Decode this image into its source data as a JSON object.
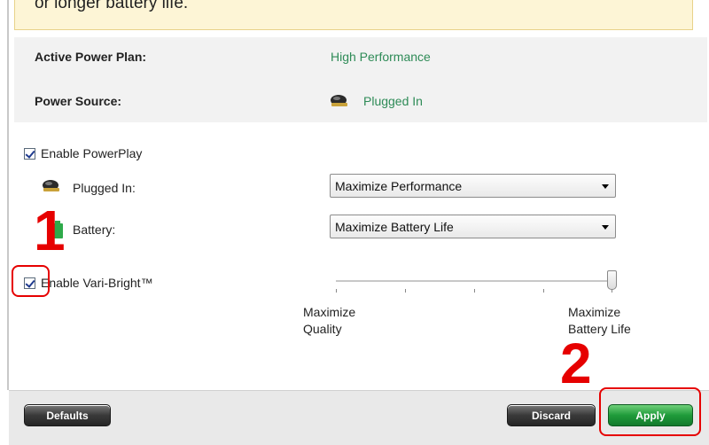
{
  "notice": {
    "text": "or longer battery life."
  },
  "info": {
    "active_plan_label": "Active Power Plan:",
    "active_plan_value": "High Performance",
    "power_source_label": "Power Source:",
    "power_source_value": "Plugged In"
  },
  "powerplay": {
    "enable_label": "Enable PowerPlay",
    "enable_checked": true,
    "plugged_label": "Plugged In:",
    "plugged_value": "Maximize Performance",
    "battery_label": "Battery:",
    "battery_value": "Maximize Battery Life"
  },
  "varibright": {
    "enable_label": "Enable Vari-Bright™",
    "enable_checked": true,
    "level": 1.0,
    "left_caption_1": "Maximize",
    "left_caption_2": "Quality",
    "right_caption_1": "Maximize",
    "right_caption_2": "Battery Life"
  },
  "footer": {
    "defaults_label": "Defaults",
    "discard_label": "Discard",
    "apply_label": "Apply"
  },
  "annotations": {
    "step1": "1",
    "step2": "2"
  },
  "colors": {
    "value_green": "#2e8b57",
    "apply_green": "#1f9b3a",
    "annotation_red": "#e60000"
  },
  "icons": [
    "mouse-plugged-icon",
    "battery-icon",
    "dropdown-arrow-icon",
    "checkmark-icon"
  ]
}
